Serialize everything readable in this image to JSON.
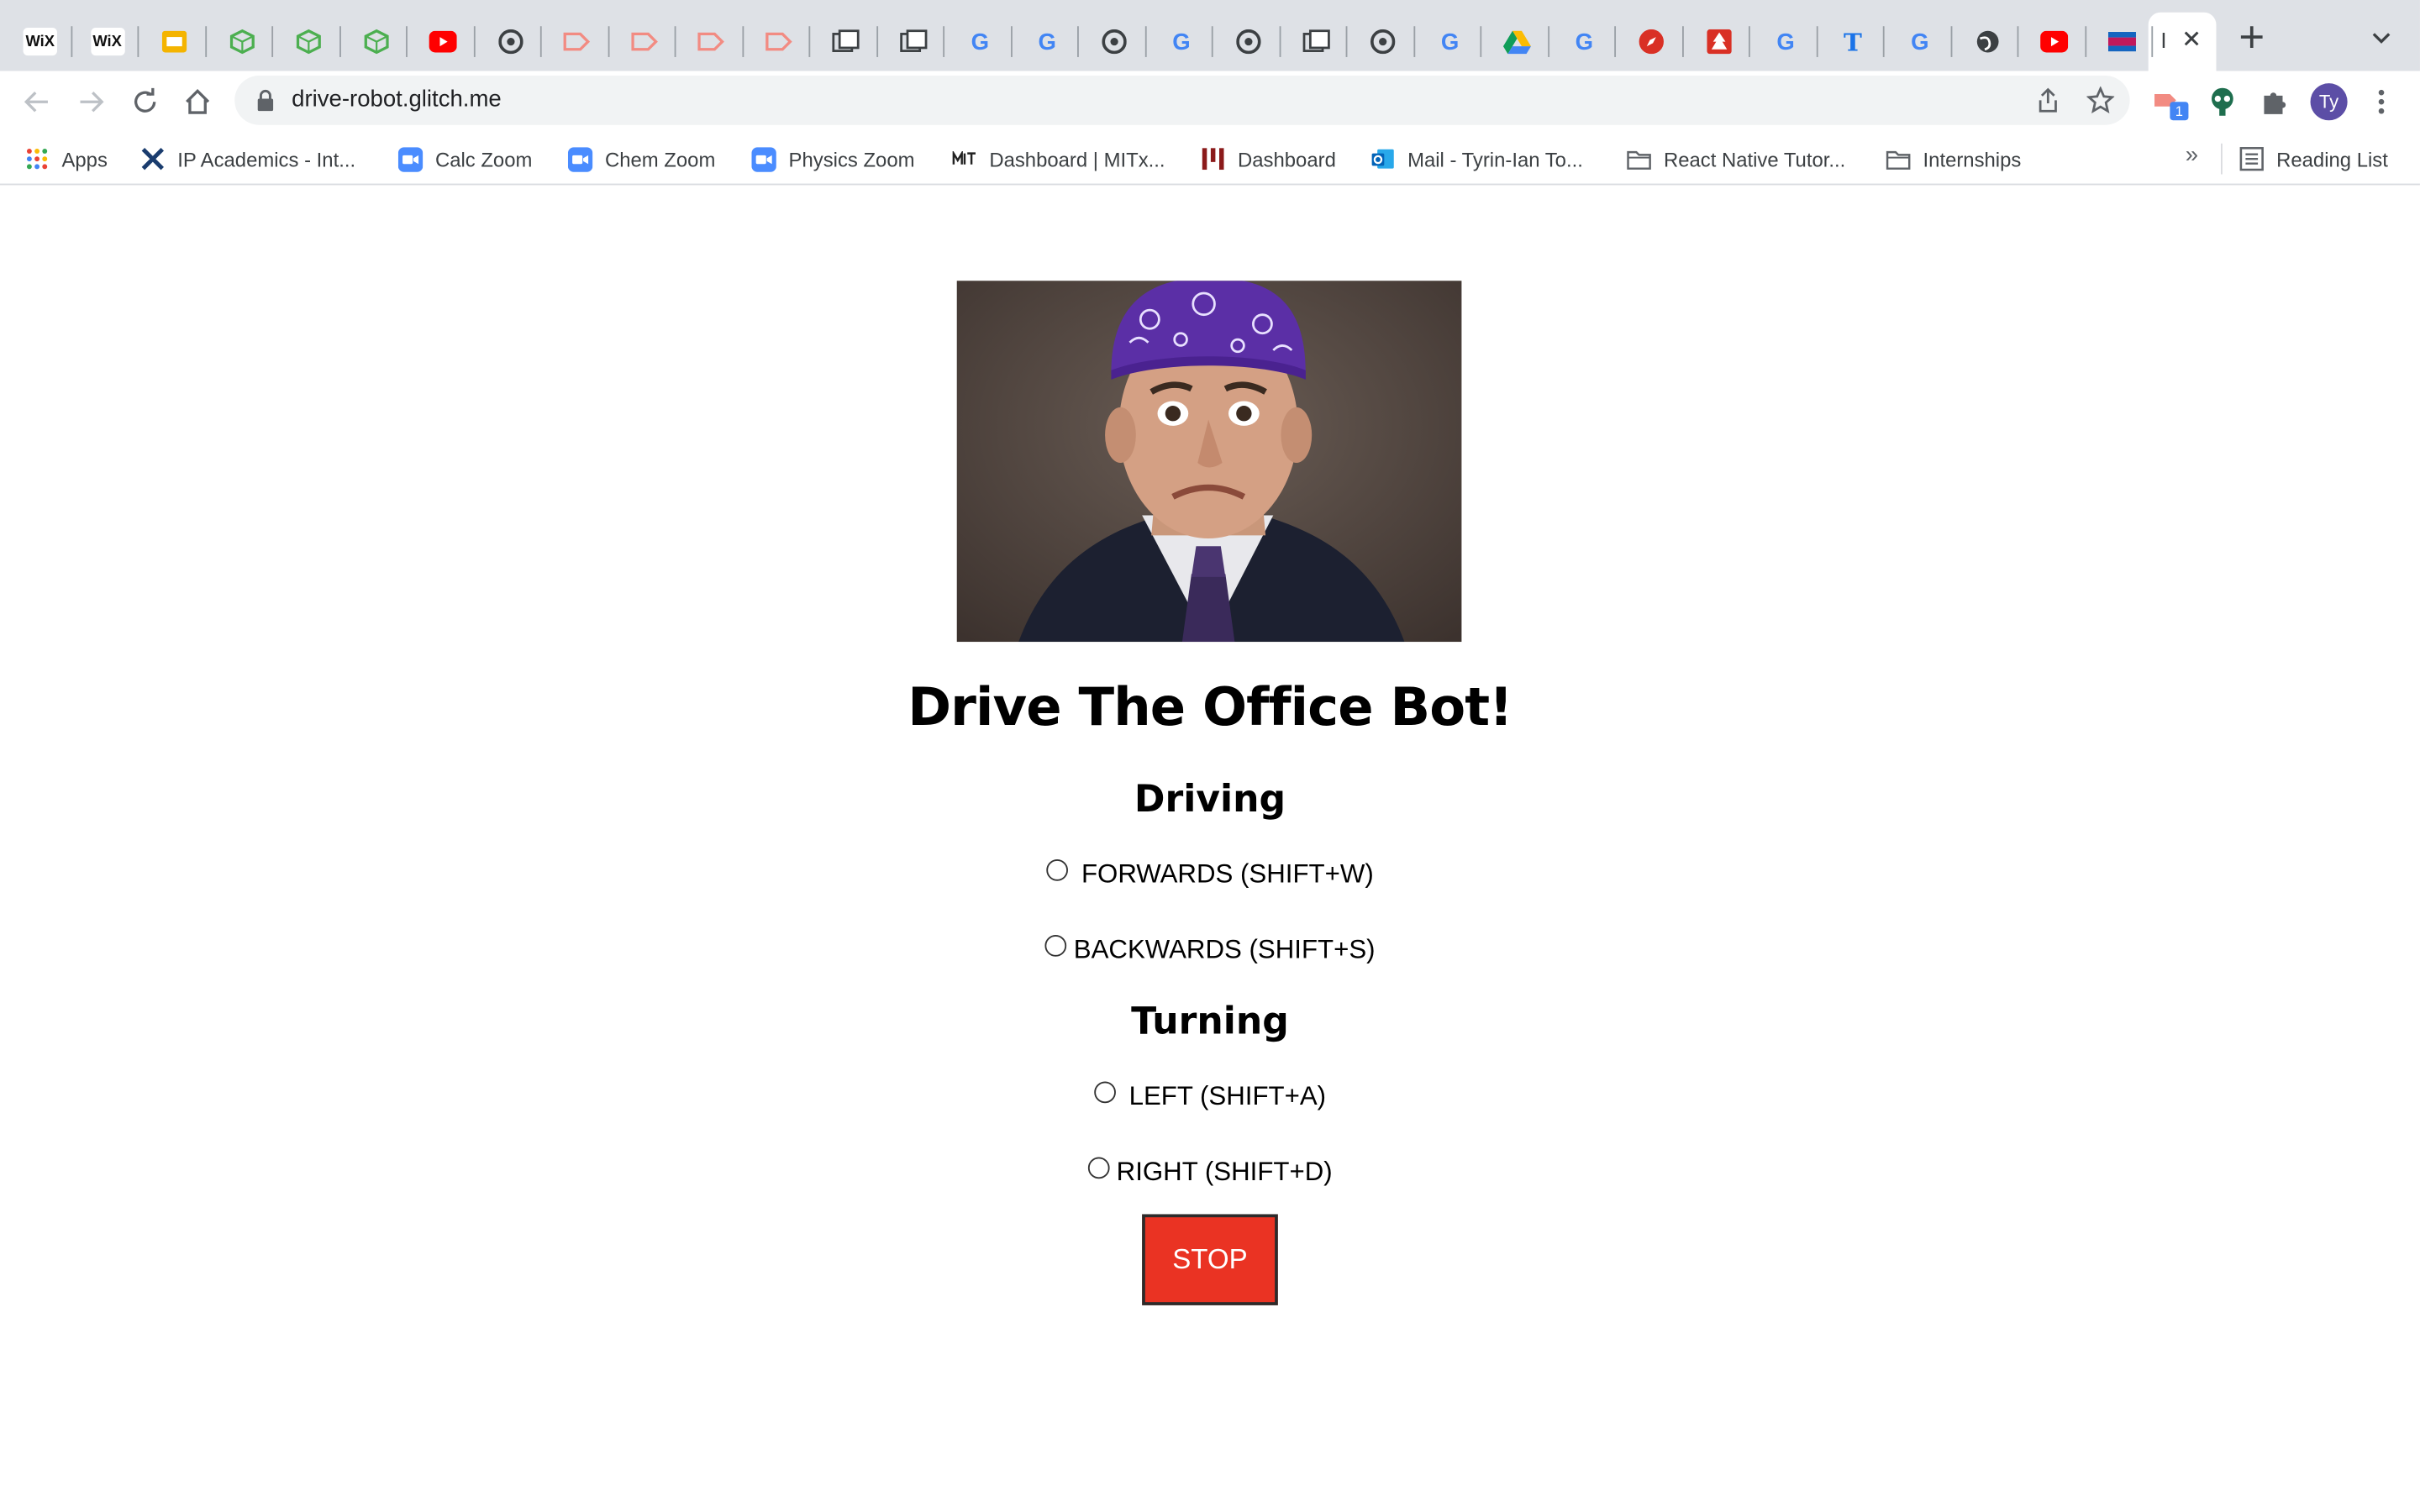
{
  "browser": {
    "url": "drive-robot.glitch.me",
    "profile_initials": "Ty",
    "extension_badge": "1",
    "active_tab_label": "I",
    "tab_favicons": [
      {
        "icon": "wix-icon",
        "text": "WiX",
        "color": "#111111"
      },
      {
        "icon": "wix-icon",
        "text": "WiX",
        "color": "#111111"
      },
      {
        "icon": "google-slides-icon",
        "text": "",
        "color": "#f4b400"
      },
      {
        "icon": "cube-icon",
        "text": "",
        "color": "#4caf50"
      },
      {
        "icon": "cube-icon",
        "text": "",
        "color": "#4caf50"
      },
      {
        "icon": "cube-icon",
        "text": "",
        "color": "#4caf50"
      },
      {
        "icon": "youtube-icon",
        "text": "",
        "color": "#ff0000"
      },
      {
        "icon": "chrome-icon",
        "text": "",
        "color": "#3c4043"
      },
      {
        "icon": "tag-icon",
        "text": "",
        "color": "#f28b82"
      },
      {
        "icon": "tag-icon",
        "text": "",
        "color": "#f28b82"
      },
      {
        "icon": "tag-icon",
        "text": "",
        "color": "#f28b82"
      },
      {
        "icon": "tag-icon",
        "text": "",
        "color": "#f28b82"
      },
      {
        "icon": "window-icon",
        "text": "",
        "color": "#3c4043"
      },
      {
        "icon": "window-icon",
        "text": "",
        "color": "#3c4043"
      },
      {
        "icon": "google-icon",
        "text": "G",
        "color": "#4285f4"
      },
      {
        "icon": "google-icon",
        "text": "G",
        "color": "#4285f4"
      },
      {
        "icon": "chrome-icon",
        "text": "",
        "color": "#3c4043"
      },
      {
        "icon": "google-icon",
        "text": "G",
        "color": "#4285f4"
      },
      {
        "icon": "chrome-icon",
        "text": "",
        "color": "#3c4043"
      },
      {
        "icon": "window-icon",
        "text": "",
        "color": "#3c4043"
      },
      {
        "icon": "chrome-icon",
        "text": "",
        "color": "#3c4043"
      },
      {
        "icon": "google-icon",
        "text": "G",
        "color": "#4285f4"
      },
      {
        "icon": "google-drive-icon",
        "text": "",
        "color": "#0f9d58"
      },
      {
        "icon": "google-icon",
        "text": "G",
        "color": "#4285f4"
      },
      {
        "icon": "compass-icon",
        "text": "",
        "color": "#d93025"
      },
      {
        "icon": "tree-icon",
        "text": "",
        "color": "#d93025"
      },
      {
        "icon": "google-icon",
        "text": "G",
        "color": "#4285f4"
      },
      {
        "icon": "text-t-icon",
        "text": "T",
        "color": "#1a73e8"
      },
      {
        "icon": "google-icon",
        "text": "G",
        "color": "#4285f4"
      },
      {
        "icon": "globe-icon",
        "text": "",
        "color": "#3c4043"
      },
      {
        "icon": "youtube-icon",
        "text": "",
        "color": "#ff0000"
      },
      {
        "icon": "flag-icon",
        "text": "",
        "color": "#c2185b"
      }
    ]
  },
  "bookmarks": [
    {
      "label": "Apps",
      "icon": "apps-grid-icon"
    },
    {
      "label": "IP Academics - Int...",
      "icon": "crossed-tools-icon"
    },
    {
      "label": "Calc Zoom",
      "icon": "zoom-icon"
    },
    {
      "label": "Chem Zoom",
      "icon": "zoom-icon"
    },
    {
      "label": "Physics Zoom",
      "icon": "zoom-icon"
    },
    {
      "label": "Dashboard | MITx...",
      "icon": "mitx-icon"
    },
    {
      "label": "Dashboard",
      "icon": "bars-icon"
    },
    {
      "label": "Mail - Tyrin-Ian To...",
      "icon": "outlook-icon"
    },
    {
      "label": "React Native Tutor...",
      "icon": "folder-icon"
    },
    {
      "label": "Internships",
      "icon": "folder-icon"
    }
  ],
  "bookmarks_overflow": "»",
  "reading_list": "Reading List",
  "page": {
    "title": "Drive The Office Bot!",
    "driving_heading": "Driving",
    "forwards": "FORWARDS (SHIFT+W)",
    "backwards": "BACKWARDS (SHIFT+S)",
    "turning_heading": "Turning",
    "left": "LEFT (SHIFT+A)",
    "right": "RIGHT (SHIFT+D)",
    "stop": "STOP"
  },
  "colors": {
    "stop_button": "#ea3323",
    "tab_strip": "#dee1e6",
    "bandana": "#5b2fa6"
  }
}
